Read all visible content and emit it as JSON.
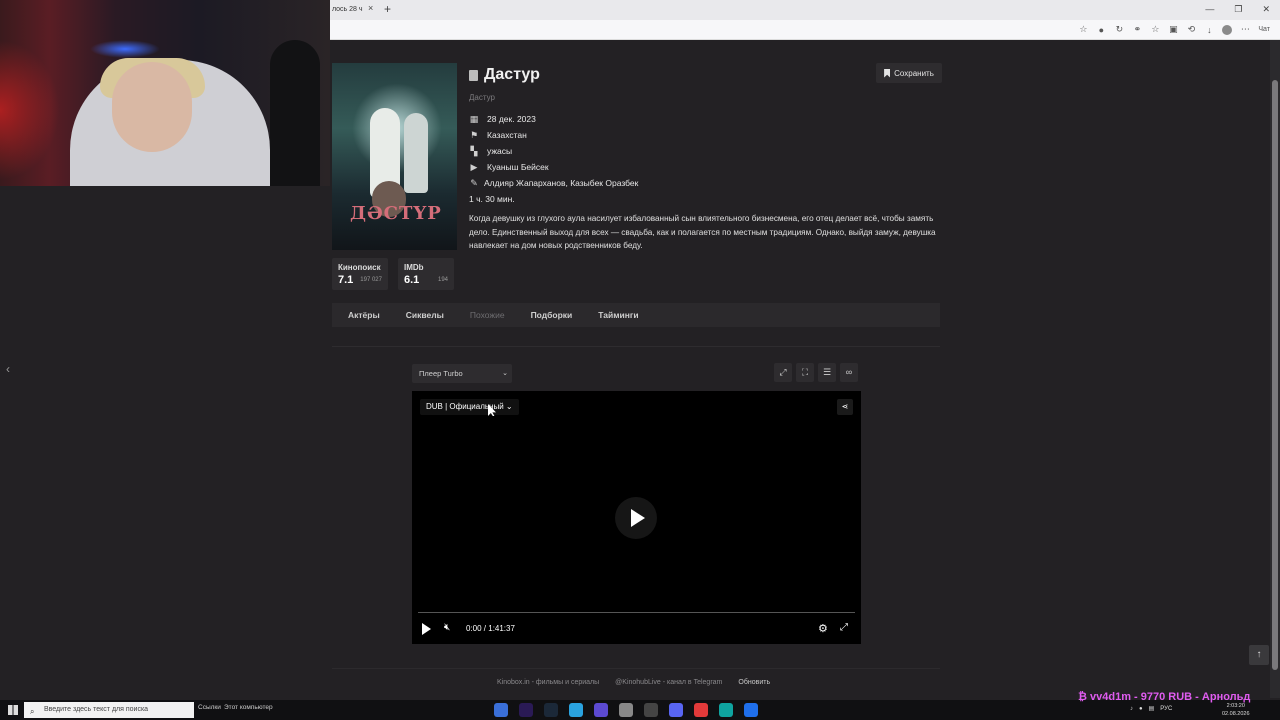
{
  "browser": {
    "tab_title": "лось 28 ч",
    "tab_close": "×",
    "new_tab": "+",
    "profile_label": "Чат"
  },
  "page": {
    "title": "Дастур",
    "original_title": "Дастур",
    "save_label": "Сохранить",
    "meta": [
      {
        "icon": "calendar-icon",
        "text": "28 дек. 2023"
      },
      {
        "icon": "flag-icon",
        "text": "Казахстан"
      },
      {
        "icon": "genre-icon",
        "text": "ужасы"
      },
      {
        "icon": "director-icon",
        "text": "Куаныш Бейсек"
      },
      {
        "icon": "pencil-icon",
        "text": "Алдияр Жапарханов, Казыбек Оразбек"
      },
      {
        "icon": "clock-icon",
        "text": "1 ч. 30 мин."
      }
    ],
    "description": "Когда девушку из глухого аула насилует избалованный сын влиятельного бизнесмена, его отец делает всё, чтобы замять дело. Единственный выход для всех — свадьба, как и полагается по местным традициям. Однако, выйдя замуж, девушка навлекает на дом новых родственников беду.",
    "poster_text": "ДӘСТҮР",
    "ratings": [
      {
        "label": "Кинопоиск",
        "value": "7.1",
        "count": "197 027"
      },
      {
        "label": "IMDb",
        "value": "6.1",
        "count": "194"
      }
    ],
    "tabs": [
      {
        "label": "Актёры",
        "active": true
      },
      {
        "label": "Сиквелы",
        "active": true
      },
      {
        "label": "Похожие",
        "active": false
      },
      {
        "label": "Подборки",
        "active": true
      },
      {
        "label": "Тайминги",
        "active": true
      }
    ]
  },
  "player": {
    "selector": "Плеер Turbo",
    "dub": "DUB | Официальный",
    "time": "0:00 / 1:41:37",
    "progress": 0
  },
  "footer": {
    "site": "Kinobox.in - фильмы и сериалы",
    "telegram": "@KinohubLive - канал в Telegram",
    "refresh": "Обновить"
  },
  "taskbar": {
    "search_placeholder": "Введите здесь текст для поиска",
    "links": "Ссылки",
    "this_pc": "Этот компьютер",
    "lang": "РУС",
    "time": "2:03:20",
    "date": "02.08.2026"
  },
  "overlay": {
    "donation": "₿ vv4d1m - 9770 RUB - Арнольд"
  },
  "colors": {
    "page_bg": "#232124",
    "panel_bg": "#2e2c2f",
    "donation": "#e05cf0"
  }
}
